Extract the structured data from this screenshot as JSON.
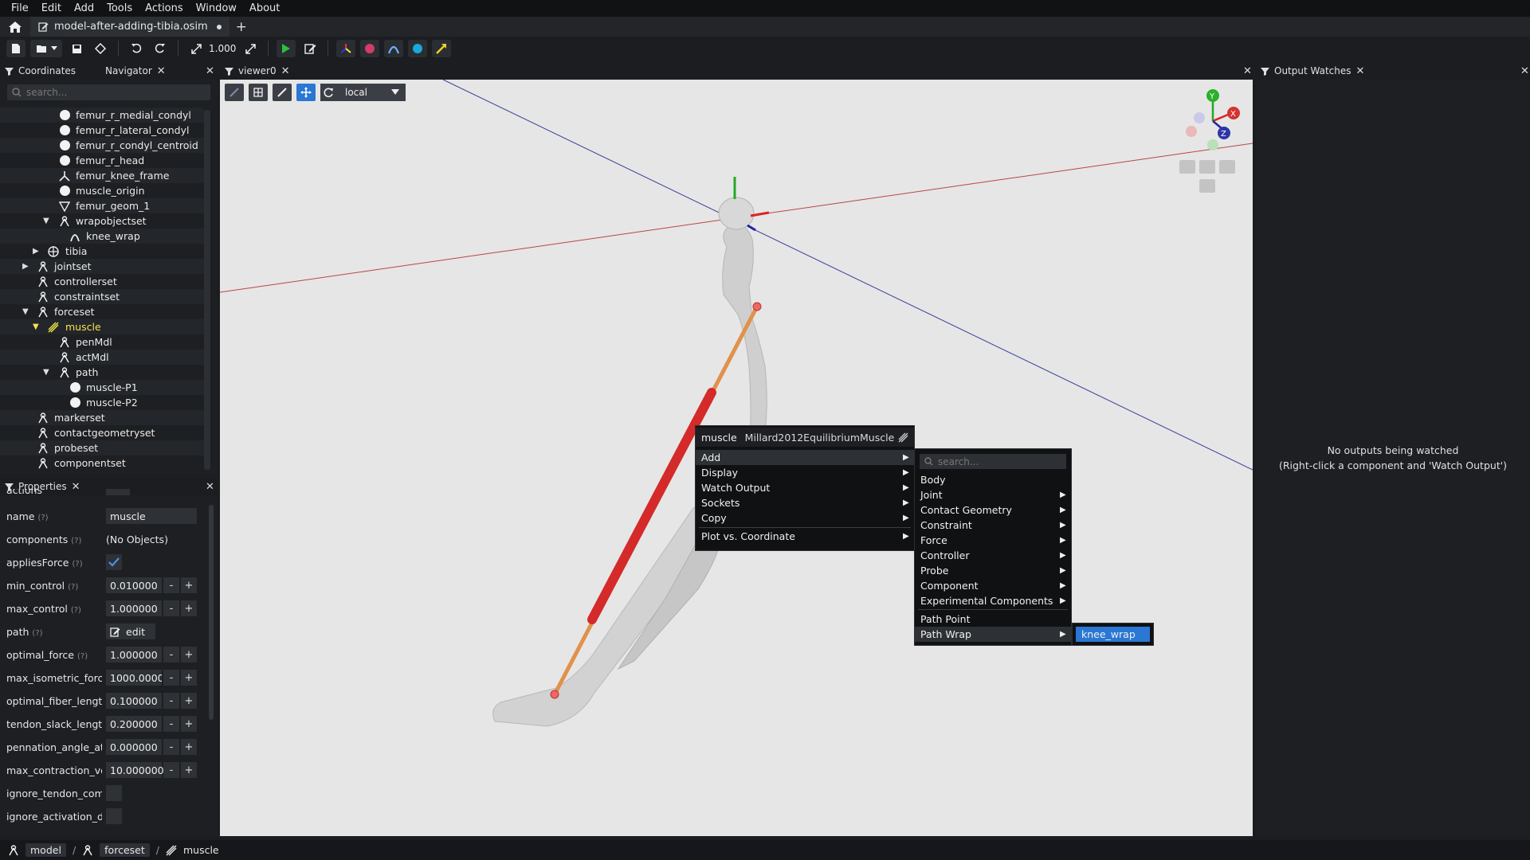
{
  "menubar": [
    "File",
    "Edit",
    "Add",
    "Tools",
    "Actions",
    "Window",
    "About"
  ],
  "tab": {
    "title": "model-after-adding-tibia.osim"
  },
  "toolbar": {
    "zoom": "1.000"
  },
  "coords_panel": {
    "tab1": "Coordinates",
    "tab2": "Navigator",
    "search_placeholder": "search..."
  },
  "tree": [
    {
      "label": "femur_r_medial_condyl"
    },
    {
      "label": "femur_r_lateral_condyl"
    },
    {
      "label": "femur_r_condyl_centroid"
    },
    {
      "label": "femur_r_head"
    },
    {
      "label": "femur_knee_frame"
    },
    {
      "label": "muscle_origin"
    },
    {
      "label": "femur_geom_1"
    },
    {
      "label": "wrapobjectset"
    },
    {
      "label": "knee_wrap"
    },
    {
      "label": "tibia"
    },
    {
      "label": "jointset"
    },
    {
      "label": "controllerset"
    },
    {
      "label": "constraintset"
    },
    {
      "label": "forceset"
    },
    {
      "label": "muscle"
    },
    {
      "label": "penMdl"
    },
    {
      "label": "actMdl"
    },
    {
      "label": "path"
    },
    {
      "label": "muscle-P1"
    },
    {
      "label": "muscle-P2"
    },
    {
      "label": "markerset"
    },
    {
      "label": "contactgeometryset"
    },
    {
      "label": "probeset"
    },
    {
      "label": "componentset"
    }
  ],
  "props_panel": {
    "title": "Properties",
    "cut_label": "actions",
    "rows": [
      {
        "name": "name",
        "value": "muscle"
      },
      {
        "name": "components",
        "value": "(No Objects)"
      },
      {
        "name": "appliesForce",
        "value": ""
      },
      {
        "name": "min_control",
        "value": "0.010000"
      },
      {
        "name": "max_control",
        "value": "1.000000"
      },
      {
        "name": "path",
        "value": "edit"
      },
      {
        "name": "optimal_force",
        "value": "1.000000"
      },
      {
        "name": "max_isometric_forc",
        "value": "1000.00000"
      },
      {
        "name": "optimal_fiber_lengt",
        "value": "0.100000"
      },
      {
        "name": "tendon_slack_lengt",
        "value": "0.200000"
      },
      {
        "name": "pennation_angle_at",
        "value": "0.000000"
      },
      {
        "name": "max_contraction_ve",
        "value": "10.000000"
      },
      {
        "name": "ignore_tendon_com",
        "value": ""
      },
      {
        "name": "ignore_activation_d",
        "value": ""
      }
    ],
    "help_mark": "(?)"
  },
  "viewer": {
    "title": "viewer0",
    "frame_select": "local"
  },
  "context_menu": {
    "header_name": "muscle",
    "header_type": "Millard2012EquilibriumMuscle",
    "items": [
      "Add",
      "Display",
      "Watch Output",
      "Sockets",
      "Copy",
      "Plot vs. Coordinate"
    ]
  },
  "add_menu": {
    "search_placeholder": "search...",
    "items": [
      "Body",
      "Joint",
      "Contact Geometry",
      "Constraint",
      "Force",
      "Controller",
      "Probe",
      "Component",
      "Experimental Components",
      "Path Point",
      "Path Wrap"
    ]
  },
  "wrap_menu": {
    "items": [
      "knee_wrap"
    ]
  },
  "output_watches": {
    "title": "Output Watches",
    "message_line1": "No outputs being watched",
    "message_line2": "(Right-click a component and 'Watch Output')"
  },
  "statusbar": {
    "crumbs": [
      "model",
      "forceset",
      "muscle"
    ]
  },
  "colors": {
    "accent": "#2a77d4",
    "selected_tree": "#f2e64a",
    "muscle": "#d42a2a"
  }
}
